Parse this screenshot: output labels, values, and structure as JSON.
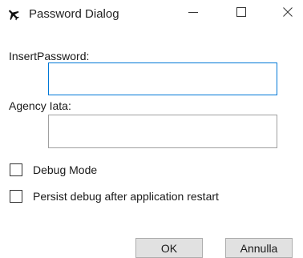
{
  "window": {
    "title": "Password Dialog",
    "app_icon": "airplane-icon",
    "caption_icons": [
      "minimize-icon",
      "maximize-icon",
      "close-icon"
    ]
  },
  "form": {
    "password_label": "InsertPassword:",
    "password_value": "",
    "agency_label": "Agency Iata:",
    "agency_value": ""
  },
  "options": {
    "debug_mode_label": "Debug Mode",
    "debug_mode_checked": false,
    "persist_debug_label": "Persist debug after application restart",
    "persist_debug_checked": false
  },
  "buttons": {
    "ok_label": "OK",
    "cancel_label": "Annulla"
  },
  "colors": {
    "focus_border": "#0078d7",
    "button_face": "#e1e1e1",
    "button_border": "#adadad"
  }
}
